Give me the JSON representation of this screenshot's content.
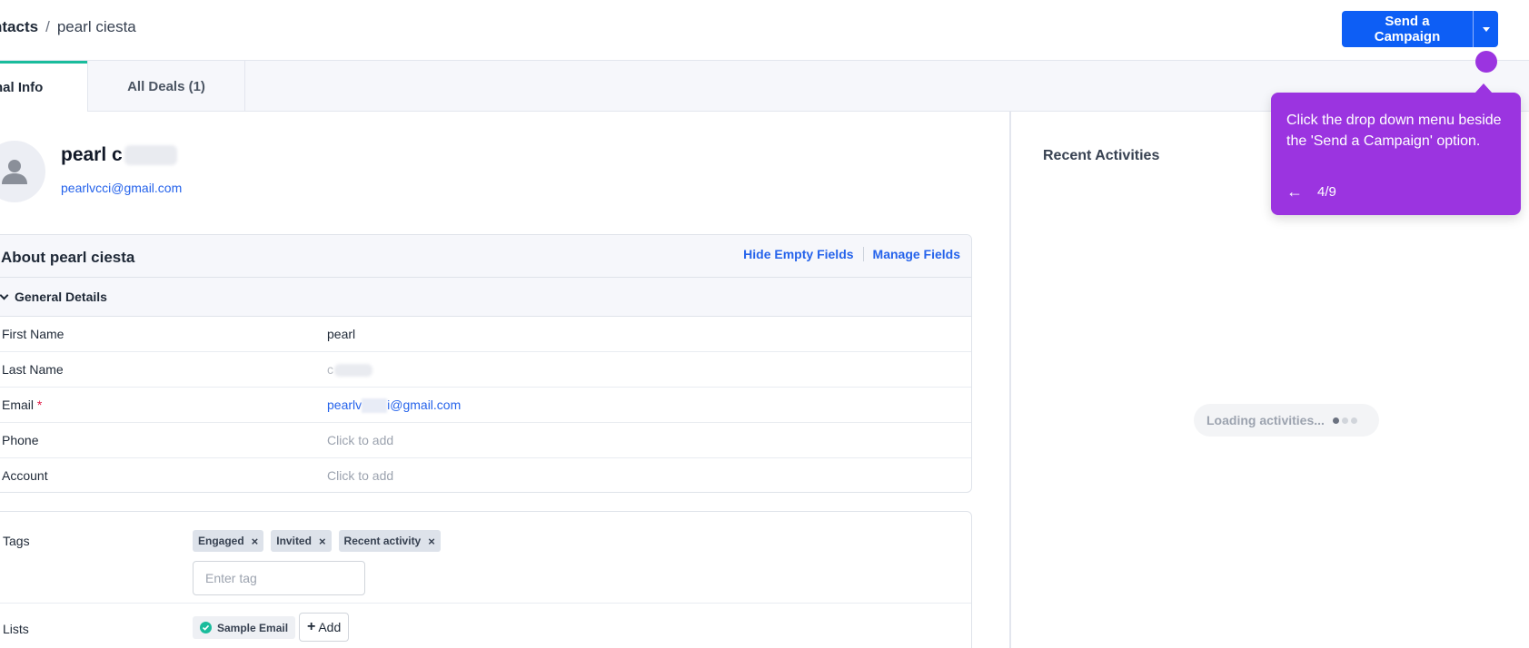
{
  "header": {
    "breadcrumb_root": "ntacts",
    "breadcrumb_sep": "/",
    "breadcrumb_current": "pearl ciesta",
    "send_campaign_label": "Send a Campaign"
  },
  "tabs": [
    {
      "label": "nal Info"
    },
    {
      "label": "All Deals (1)"
    }
  ],
  "contact": {
    "name": "pearl c",
    "email": "pearlvcci@gmail.com"
  },
  "about": {
    "title": "About pearl ciesta",
    "hide_empty": "Hide Empty Fields",
    "manage_fields": "Manage Fields",
    "section": "General Details",
    "fields": [
      {
        "label": "First Name",
        "value": "pearl"
      },
      {
        "label": "Last Name",
        "value": "c"
      },
      {
        "label": "Email",
        "required": "*",
        "value_prefix": "pearlv",
        "value_suffix": "i@gmail.com"
      },
      {
        "label": "Phone",
        "value": "Click to add"
      },
      {
        "label": "Account",
        "value": "Click to add"
      }
    ]
  },
  "tags": {
    "label": "Tags",
    "items": [
      "Engaged",
      "Invited",
      "Recent activity"
    ],
    "remove_glyph": "×",
    "input_placeholder": "Enter tag"
  },
  "lists": {
    "label": "Lists",
    "items": [
      "Sample Email"
    ],
    "add_label": "Add"
  },
  "activities": {
    "title": "Recent Activities",
    "loading": "Loading activities..."
  },
  "tooltip": {
    "text": "Click the drop down menu beside the 'Send a Campaign' option.",
    "step": "4/9",
    "back_glyph": "←"
  },
  "colors": {
    "primary": "#0d5ef5",
    "accent_tab": "#1abc9c",
    "tooltip": "#9b34e0",
    "link": "#2563eb"
  }
}
